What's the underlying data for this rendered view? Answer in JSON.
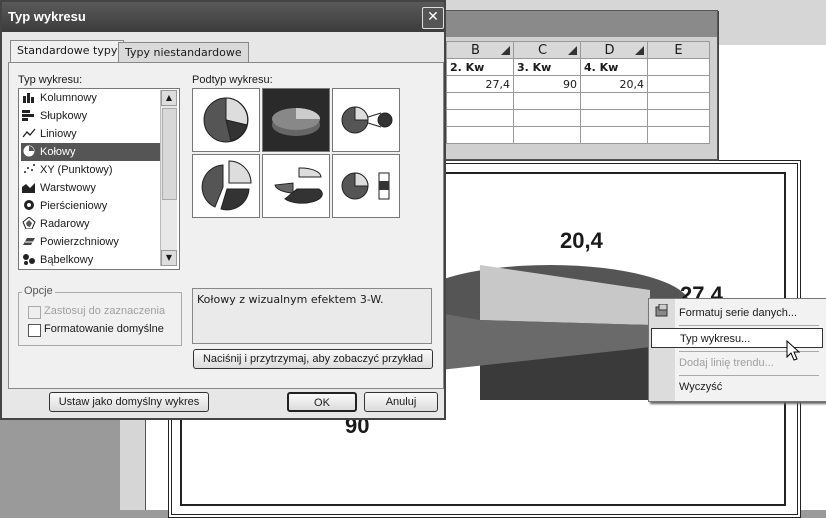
{
  "dialog": {
    "title": "Typ wykresu",
    "close_label": "✕",
    "tabs": [
      {
        "label": "Standardowe typy",
        "active": true
      },
      {
        "label": "Typy niestandardowe",
        "active": false
      }
    ],
    "chart_type_label": "Typ wykresu:",
    "chart_types": [
      {
        "label": "Kolumnowy",
        "icon": "column-chart-icon"
      },
      {
        "label": "Słupkowy",
        "icon": "bar-chart-icon"
      },
      {
        "label": "Liniowy",
        "icon": "line-chart-icon"
      },
      {
        "label": "Kołowy",
        "icon": "pie-chart-icon",
        "selected": true
      },
      {
        "label": "XY (Punktowy)",
        "icon": "scatter-chart-icon"
      },
      {
        "label": "Warstwowy",
        "icon": "area-chart-icon"
      },
      {
        "label": "Pierścieniowy",
        "icon": "doughnut-chart-icon"
      },
      {
        "label": "Radarowy",
        "icon": "radar-chart-icon"
      },
      {
        "label": "Powierzchniowy",
        "icon": "surface-chart-icon"
      },
      {
        "label": "Bąbelkowy",
        "icon": "bubble-chart-icon"
      }
    ],
    "subtype_label": "Podtyp wykresu:",
    "options_label": "Opcje",
    "option_apply_selection": "Zastosuj do zaznaczenia",
    "option_default_format": "Formatowanie domyślne",
    "description": "Kołowy z wizualnym efektem 3-W.",
    "preview_button": "Naciśnij i przytrzymaj, aby zobaczyć przykład",
    "set_default_button": "Ustaw jako domyślny wykres",
    "ok_button": "OK",
    "cancel_button": "Anuluj"
  },
  "spreadsheet": {
    "columns": [
      "B",
      "C",
      "D",
      "E"
    ],
    "row1": [
      "2. Kw",
      "3. Kw",
      "4. Kw",
      ""
    ],
    "row2": [
      "27,4",
      "90",
      "20,4",
      ""
    ]
  },
  "chart": {
    "label_top": "20,4",
    "label_right": "27,4",
    "label_bottom": "90"
  },
  "context_menu": {
    "items": [
      {
        "label": "Formatuj serie danych...",
        "state": "normal"
      },
      {
        "label": "Typ wykresu...",
        "state": "highlighted"
      },
      {
        "label": "Dodaj linię trendu...",
        "state": "disabled"
      },
      {
        "label": "Wyczyść",
        "state": "normal"
      }
    ]
  },
  "colors": {
    "title_bar": "#4a4a4a",
    "selected_item": "#555555"
  }
}
